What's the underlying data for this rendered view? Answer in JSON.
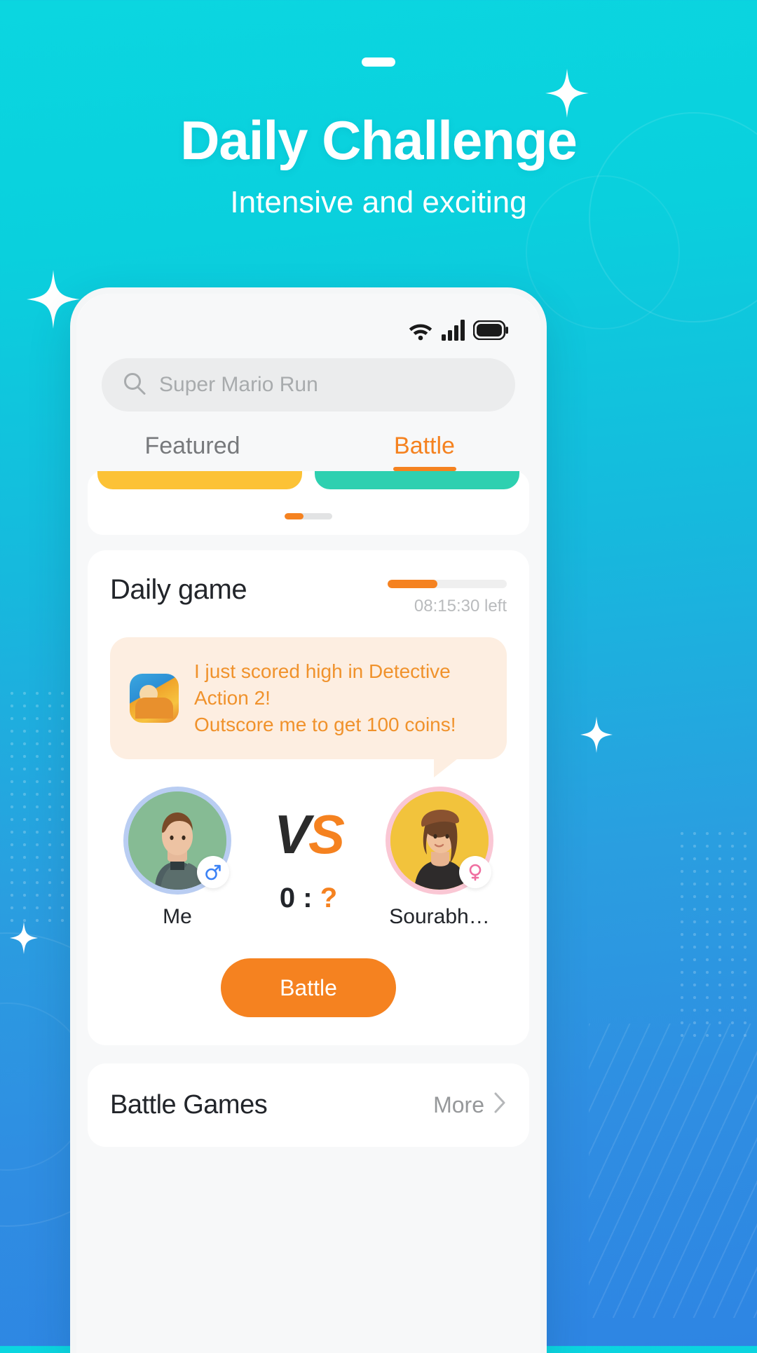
{
  "promo": {
    "headline": "Daily Challenge",
    "subhead": "Intensive and exciting"
  },
  "phone": {
    "statusbar": {
      "wifi_icon": "wifi-icon",
      "signal_icon": "cellular-signal-icon",
      "battery_icon": "battery-full-icon"
    },
    "search": {
      "icon": "search-icon",
      "placeholder": "Super Mario Run",
      "value": ""
    },
    "tabs": [
      {
        "label": "Featured",
        "active": false
      },
      {
        "label": "Battle",
        "active": true
      }
    ],
    "carousel": {
      "page_indicator": "carousel-page-indicator"
    },
    "daily_game": {
      "title": "Daily game",
      "progress_percent": 42,
      "time_left": "08:15:30 left",
      "bubble": {
        "game_thumb": "detective-action-2-game-icon",
        "line1": "I just scored high in Detective Action 2!",
        "line2": "Outscore me to get 100 coins!"
      },
      "players": {
        "me": {
          "name": "Me",
          "gender_icon": "male-gender-icon",
          "score": "0"
        },
        "opponent": {
          "name": "Sourabh…",
          "gender_icon": "female-gender-icon",
          "score": "?"
        }
      },
      "vs_label_v": "V",
      "vs_label_s": "S",
      "score_separator": ":",
      "battle_button": "Battle"
    },
    "battle_games": {
      "title": "Battle Games",
      "more_label": "More",
      "chevron_icon": "chevron-right-icon"
    }
  },
  "colors": {
    "accent_orange": "#f58220",
    "bg_cyan": "#0bd6e0",
    "bg_blue": "#2e85e3",
    "card_yellow": "#fcc236",
    "card_teal": "#2ed0b0"
  }
}
